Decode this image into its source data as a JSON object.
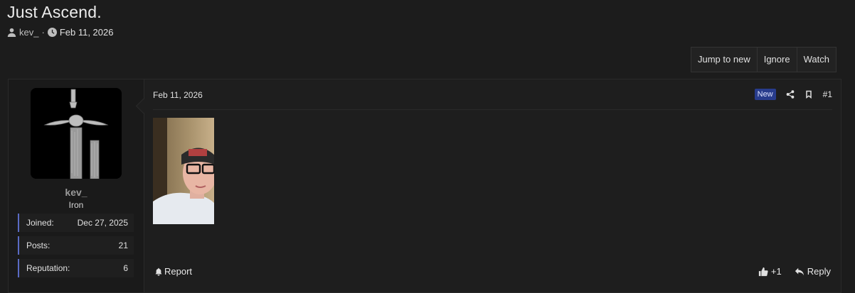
{
  "thread": {
    "title": "Just Ascend.",
    "author": "kev_",
    "separator": "·",
    "date": "Feb 11, 2026"
  },
  "actions": {
    "jump_to_new": "Jump to new",
    "ignore": "Ignore",
    "watch": "Watch"
  },
  "user": {
    "name": "kev_",
    "rank": "Iron",
    "stats": [
      {
        "label": "Joined:",
        "value": "Dec 27, 2025"
      },
      {
        "label": "Posts:",
        "value": "21"
      },
      {
        "label": "Reputation:",
        "value": "6"
      }
    ]
  },
  "post": {
    "date": "Feb 11, 2026",
    "badge": "New",
    "number": "#1",
    "report": "Report",
    "reaction_count": "+1",
    "reply": "Reply"
  },
  "colors": {
    "accent_border": "#5a6bc4",
    "badge_bg": "#283c8c",
    "background": "#1c1c1c"
  }
}
